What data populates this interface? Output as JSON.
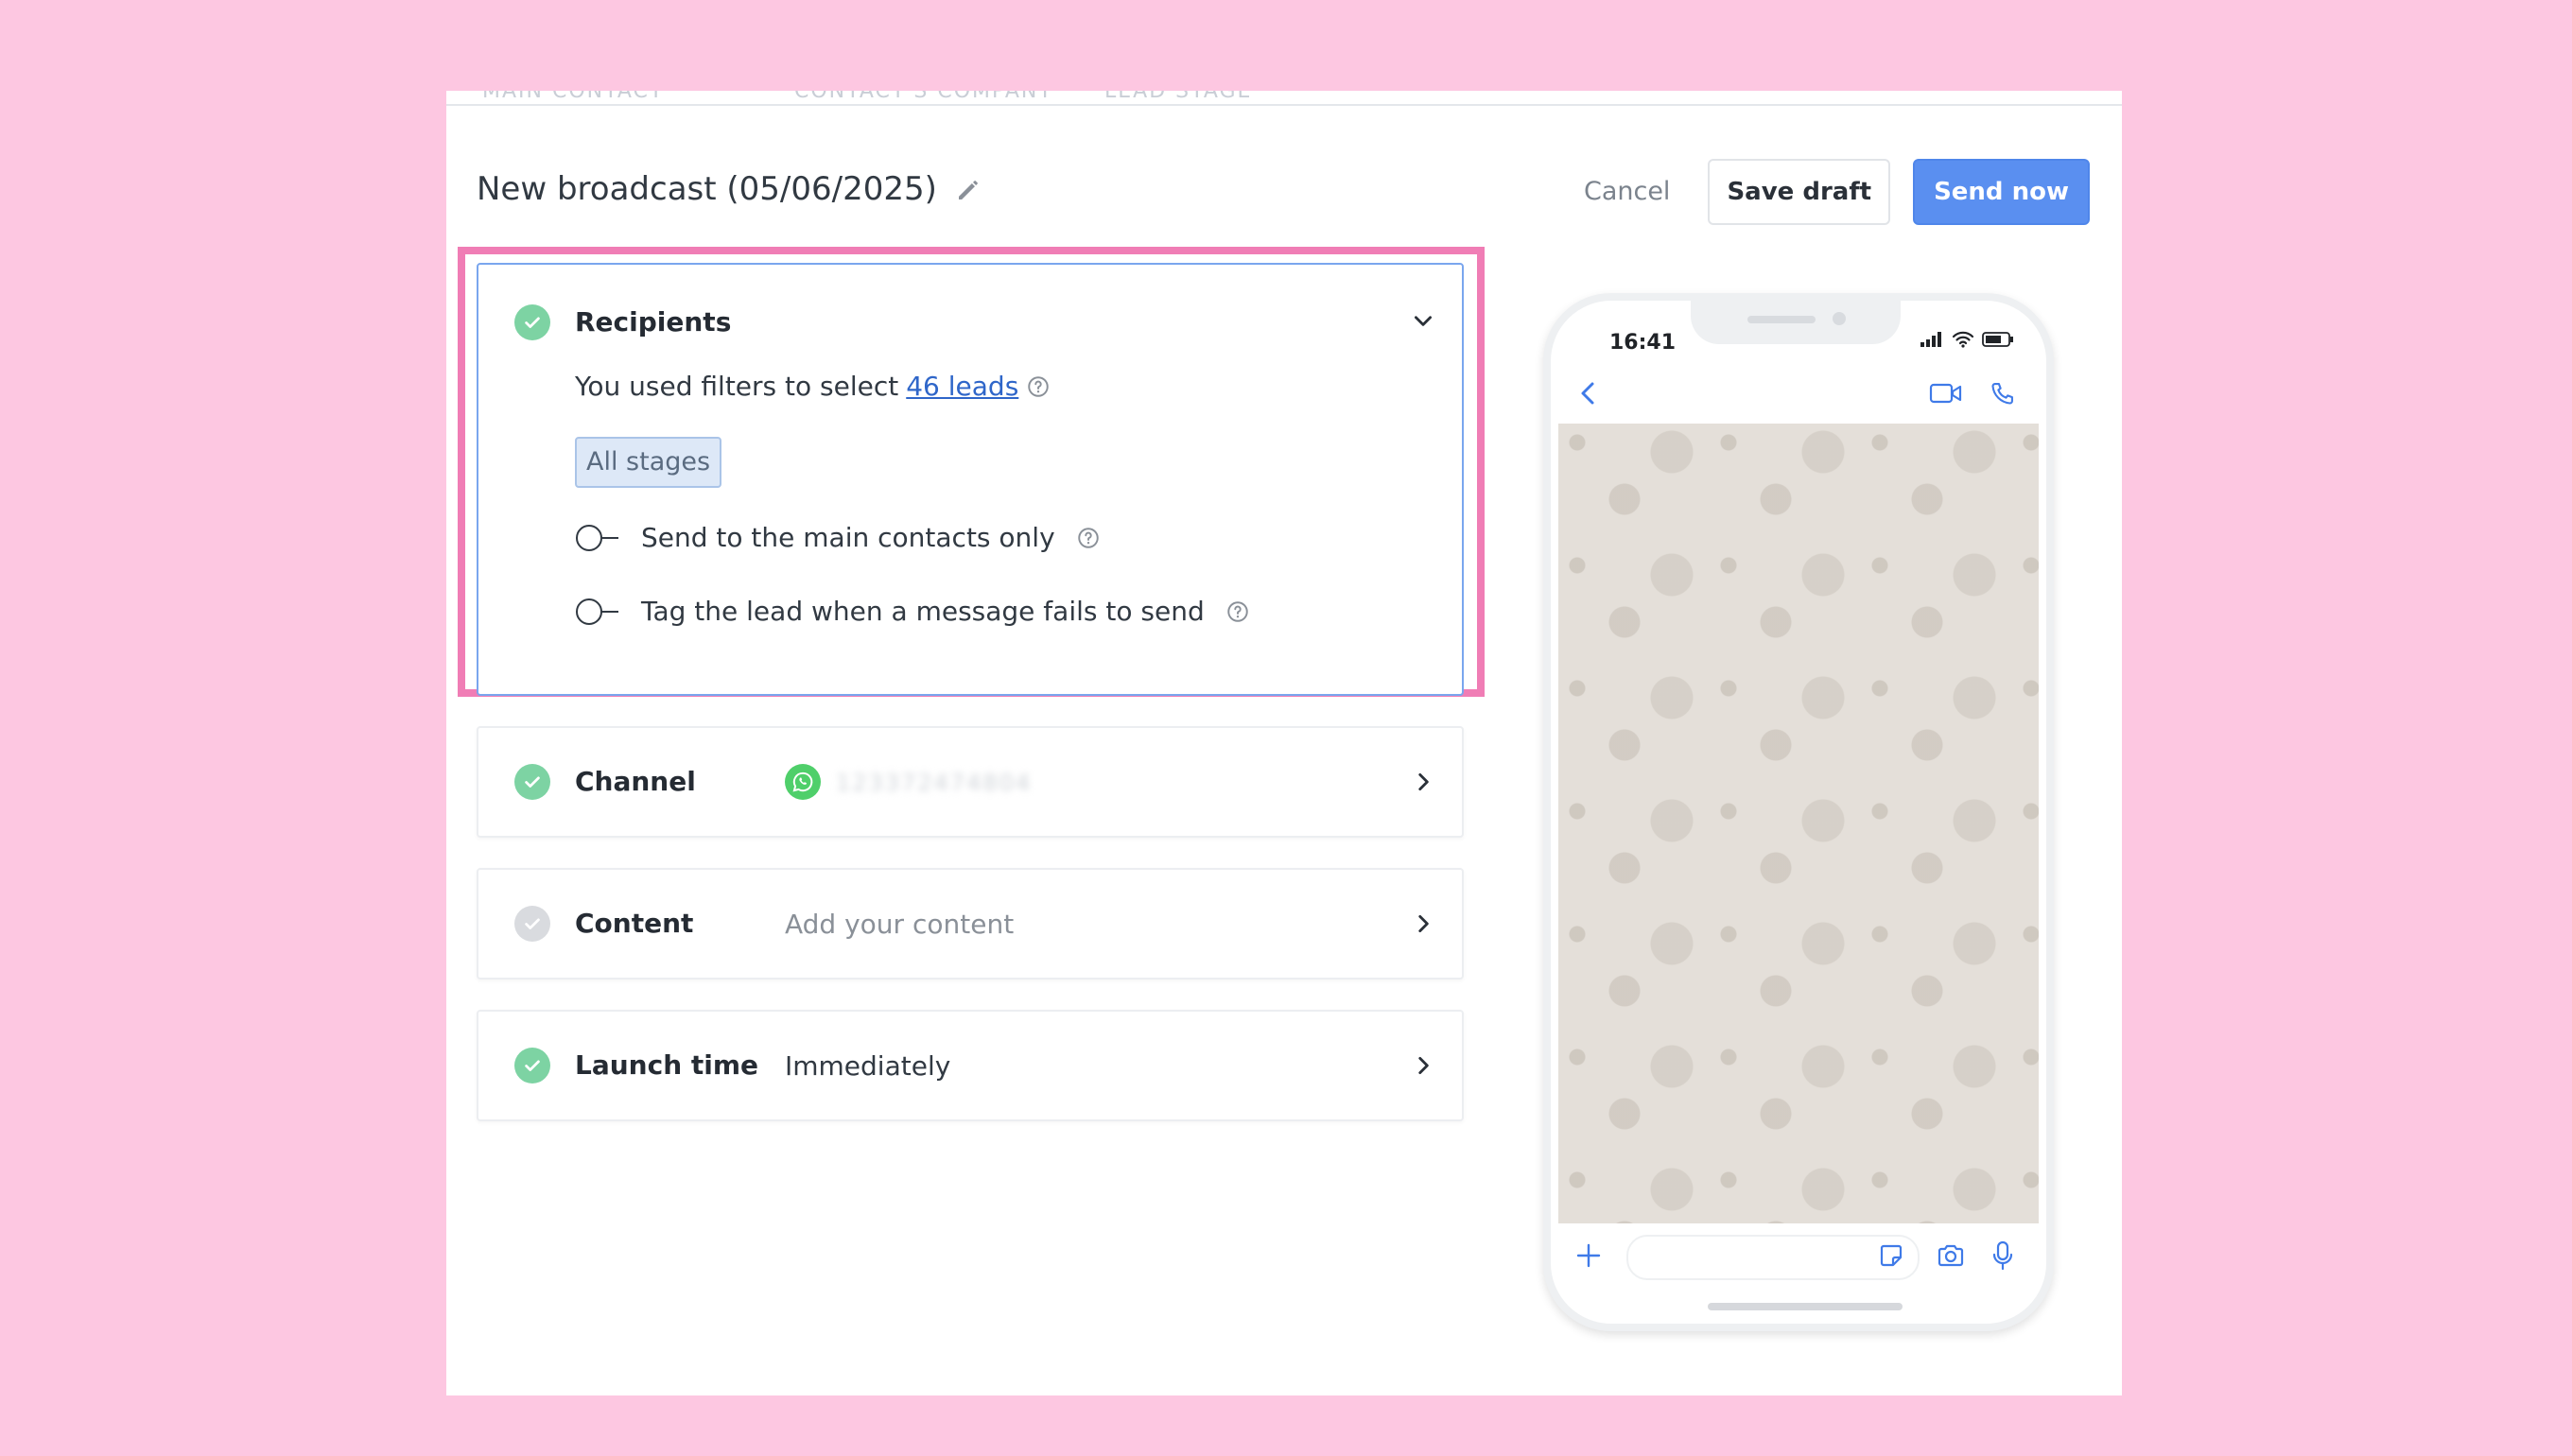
{
  "background_columns": [
    "MAIN CONTACT",
    "CONTACT'S COMPANY",
    "LEAD STAGE"
  ],
  "modal": {
    "title": "New broadcast (05/06/2025)",
    "cancel_label": "Cancel",
    "save_draft_label": "Save draft",
    "send_now_label": "Send now"
  },
  "recipients": {
    "title": "Recipients",
    "filters_prefix": "You used filters to select",
    "leads_link": "46 leads",
    "stage_tag": "All stages",
    "toggle_main_contacts": "Send to the main contacts only",
    "toggle_tag_lead": "Tag the lead when a message fails to send"
  },
  "channel": {
    "title": "Channel",
    "value": "123372474804",
    "icon": "whatsapp-icon"
  },
  "content": {
    "title": "Content",
    "placeholder": "Add your content"
  },
  "launch_time": {
    "title": "Launch time",
    "value": "Immediately"
  },
  "phone": {
    "time": "16:41"
  },
  "colors": {
    "accent": "#5a8ff0",
    "highlight": "#f07db5",
    "success": "#7dd3a3",
    "link": "#2f66c9"
  }
}
